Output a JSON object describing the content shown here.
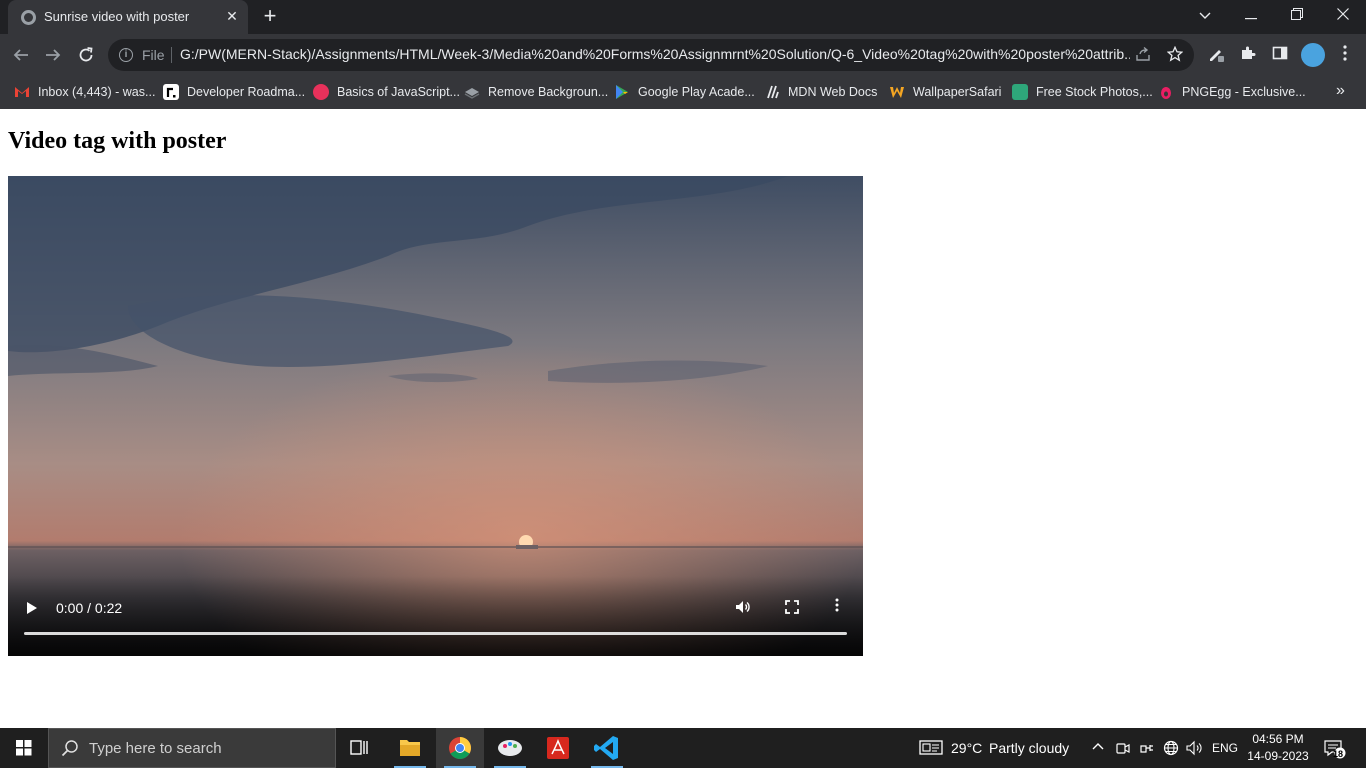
{
  "browser": {
    "tab_title": "Sunrise video with poster",
    "tab_close": "✕",
    "new_tab": "+",
    "url_scheme_label": "File",
    "url": "G:/PW(MERN-Stack)/Assignments/HTML/Week-3/Media%20and%20Forms%20Assignmrnt%20Solution/Q-6_Video%20tag%20with%20poster%20attrib...",
    "bookmarks": [
      {
        "label": "Inbox (4,443) - was...",
        "icon": "gmail-icon",
        "color": "#ea4335"
      },
      {
        "label": "Developer Roadma...",
        "icon": "roadmap-icon",
        "color": "#ffffff"
      },
      {
        "label": "Basics of JavaScript...",
        "icon": "js-basics-icon",
        "color": "#e8315b"
      },
      {
        "label": "Remove Backgroun...",
        "icon": "remove-bg-icon",
        "color": "#9aa0a6"
      },
      {
        "label": "Google Play Acade...",
        "icon": "google-play-icon",
        "color": "#34a853"
      },
      {
        "label": "MDN Web Docs",
        "icon": "mdn-icon",
        "color": "#ffffff"
      },
      {
        "label": "WallpaperSafari",
        "icon": "wallpapersafari-icon",
        "color": "#f5a623"
      },
      {
        "label": "Free Stock Photos,...",
        "icon": "stock-photos-icon",
        "color": "#2ea77a"
      },
      {
        "label": "PNGEgg - Exclusive...",
        "icon": "pngegg-icon",
        "color": "#e91e63"
      }
    ],
    "bookmarks_overflow": "»"
  },
  "page": {
    "heading": "Video tag with poster",
    "video": {
      "current_time": "0:00",
      "duration": "0:22",
      "time_display": "0:00 / 0:22",
      "progress": 0
    }
  },
  "taskbar": {
    "search_placeholder": "Type here to search",
    "weather_temp": "29°C",
    "weather_desc": "Partly cloudy",
    "language": "ENG",
    "time": "04:56 PM",
    "date": "14-09-2023",
    "notification_count": "18",
    "apps": [
      "task-view",
      "file-explorer",
      "chrome",
      "paint-3d",
      "acrobat-reader",
      "vscode"
    ]
  },
  "colors": {
    "chrome_dark": "#202124",
    "chrome_toolbar": "#35363a",
    "taskbar": "#1f1f1f",
    "accent": "#76b9ed"
  }
}
